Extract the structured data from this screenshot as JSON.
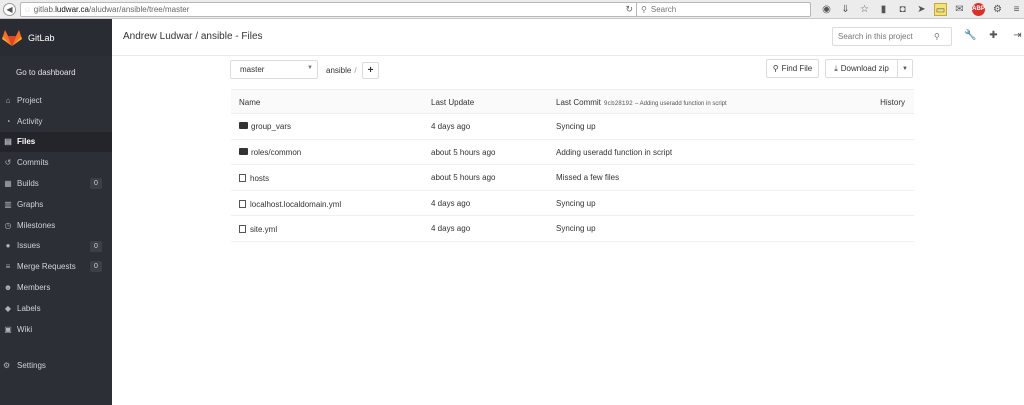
{
  "browser": {
    "url_prefix": "gitlab.",
    "url_host": "ludwar.ca",
    "url_path": "/aludwar/ansible/tree/master",
    "search_placeholder": "Search"
  },
  "sidebar": {
    "brand": "GitLab",
    "dashboard": "Go to dashboard",
    "items": [
      {
        "label": "Project",
        "icon": "home-icon",
        "glyph": "⌂"
      },
      {
        "label": "Activity",
        "icon": "dashboard-icon",
        "glyph": "◔"
      },
      {
        "label": "Files",
        "icon": "files-icon",
        "glyph": "▤",
        "active": true
      },
      {
        "label": "Commits",
        "icon": "history-icon",
        "glyph": "↺"
      },
      {
        "label": "Builds",
        "icon": "builds-icon",
        "glyph": "▦",
        "badge": "0"
      },
      {
        "label": "Graphs",
        "icon": "graph-icon",
        "glyph": "▥"
      },
      {
        "label": "Milestones",
        "icon": "clock-icon",
        "glyph": "◷"
      },
      {
        "label": "Issues",
        "icon": "issues-icon",
        "glyph": "●",
        "badge": "0"
      },
      {
        "label": "Merge Requests",
        "icon": "merge-icon",
        "glyph": "≡",
        "badge": "0"
      },
      {
        "label": "Members",
        "icon": "users-icon",
        "glyph": "☻"
      },
      {
        "label": "Labels",
        "icon": "tags-icon",
        "glyph": "◆"
      },
      {
        "label": "Wiki",
        "icon": "book-icon",
        "glyph": "▣"
      }
    ],
    "settings": "Settings"
  },
  "header": {
    "title": "Andrew Ludwar / ansible - Files",
    "search_placeholder": "Search in this project"
  },
  "toolbar": {
    "branch": "master",
    "crumb": "ansible",
    "crumb_sep": "/",
    "add_label": "+",
    "find_file": "Find File",
    "download_zip": "Download zip"
  },
  "table": {
    "headers": {
      "name": "Name",
      "last_update": "Last Update",
      "last_commit": "Last Commit",
      "commit_sha": "9cb28192",
      "commit_msg": "– Adding useradd function in script",
      "history": "History"
    },
    "rows": [
      {
        "name": "group_vars",
        "type": "folder",
        "updated": "4 days ago",
        "commit": "Syncing up"
      },
      {
        "name": "roles/common",
        "type": "folder",
        "updated": "about 5 hours ago",
        "commit": "Adding useradd function in script"
      },
      {
        "name": "hosts",
        "type": "file",
        "updated": "about 5 hours ago",
        "commit": "Missed a few files"
      },
      {
        "name": "localhost.localdomain.yml",
        "type": "file",
        "updated": "4 days ago",
        "commit": "Syncing up"
      },
      {
        "name": "site.yml",
        "type": "file",
        "updated": "4 days ago",
        "commit": "Syncing up"
      }
    ]
  },
  "colors": {
    "sidebar_bg": "#2d2f36",
    "sidebar_active": "#23252b",
    "gitlab_orange": "#e24329"
  }
}
